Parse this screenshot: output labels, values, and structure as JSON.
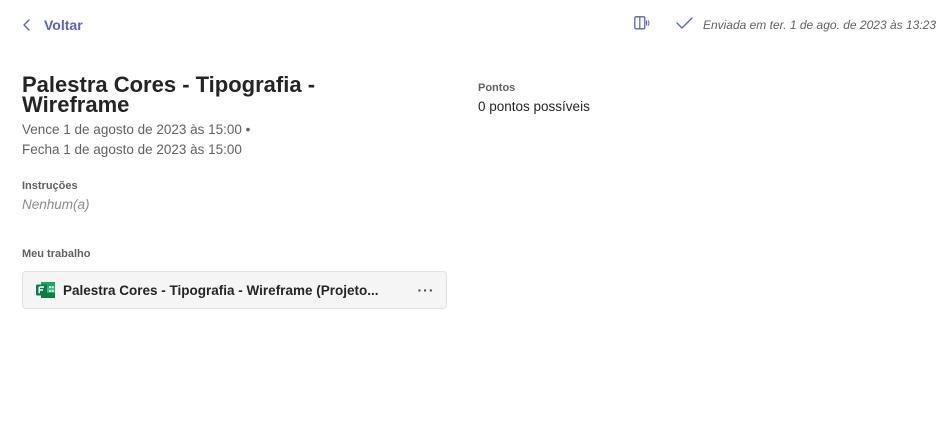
{
  "header": {
    "back_label": "Voltar",
    "submitted_text": "Enviada em ter. 1 de ago. de 2023 às 13:23",
    "accent_color": "#5b5fc7"
  },
  "assignment": {
    "title": "Palestra Cores - Tipografia - Wireframe",
    "due_line": "Vence 1 de agosto de 2023 às 15:00 •",
    "close_line": "Fecha 1 de agosto de 2023 às 15:00",
    "instructions_label": "Instruções",
    "instructions_value": "Nenhum(a)",
    "my_work_label": "Meu trabalho",
    "attachment": {
      "name": "Palestra Cores - Tipografia - Wireframe (Projeto...",
      "icon": "forms-icon",
      "more_label": "···"
    }
  },
  "points": {
    "label": "Pontos",
    "value": "0 pontos possíveis"
  }
}
